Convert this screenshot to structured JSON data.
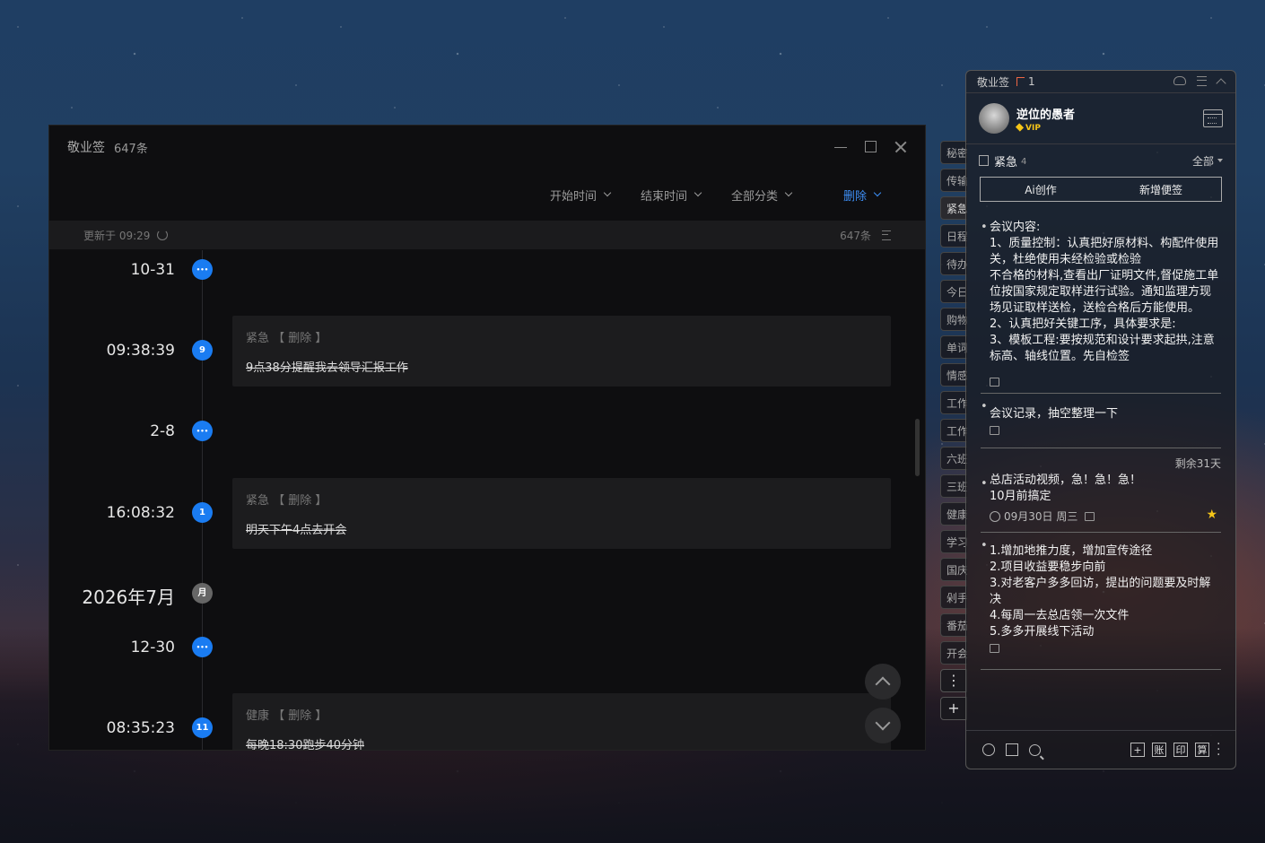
{
  "main": {
    "app_name": "敬业签",
    "count_title": "647条",
    "filters": {
      "start_time": "开始时间",
      "end_time": "结束时间",
      "category": "全部分类",
      "delete": "删除"
    },
    "updated": "更新于 09:29",
    "total": "647条",
    "timeline": [
      {
        "label": "10-31",
        "dot": "more"
      },
      {
        "label": "09:38:39",
        "dot": "9",
        "card": {
          "category": "紧急",
          "action": "【 删除 】",
          "text": "9点38分提醒我去领导汇报工作"
        }
      },
      {
        "label": "2-8",
        "dot": "more"
      },
      {
        "label": "16:08:32",
        "dot": "1",
        "card": {
          "category": "紧急",
          "action": "【 删除 】",
          "text": "明天下午4点去开会"
        }
      },
      {
        "label": "2026年7月",
        "dot": "月"
      },
      {
        "label": "12-30",
        "dot": "more"
      },
      {
        "label": "08:35:23",
        "dot": "11",
        "card": {
          "category": "健康",
          "action": "【 删除 】",
          "text": "每晚18:30跑步40分钟"
        }
      }
    ]
  },
  "tabs": [
    "秘密",
    "传输",
    "紧急",
    "日程",
    "待办",
    "今日",
    "购物",
    "单词",
    "情感",
    "工作",
    "工作",
    "六班",
    "三班",
    "健康",
    "学习",
    "国庆",
    "剁手",
    "番茄",
    "开会"
  ],
  "panel": {
    "app_name": "敬业签",
    "flag_count": "1",
    "user_name": "逆位的愚者",
    "vip": "VIP",
    "category": "紧急",
    "category_count": "4",
    "filter": "全部",
    "ai_button": "Ai创作",
    "new_button": "新增便签",
    "notes": [
      {
        "text": "会议内容:\n1、质量控制：认真把好原材料、构配件使用关，杜绝使用未经检验或检验\n不合格的材料,查看出厂证明文件,督促施工单位按国家规定取样进行试验。通知监理方现场见证取样送检，送检合格后方能使用。\n2、认真把好关键工序，具体要求是:\n3、模板工程:要按规范和设计要求起拱,注意标高、轴线位置。先自检签"
      },
      {
        "text": "会议记录，抽空整理一下"
      },
      {
        "remaining": "剩余31天",
        "text": "总店活动视频，急！急！急！\n10月前搞定",
        "date": "09月30日 周三"
      },
      {
        "text": "1.增加地推力度，增加宣传途径\n2.项目收益要稳步向前\n3.对老客户多多回访，提出的问题要及时解决\n4.每周一去总店领一次文件\n5.多多开展线下活动"
      }
    ],
    "bottom_buttons": [
      "账",
      "印",
      "算"
    ]
  }
}
